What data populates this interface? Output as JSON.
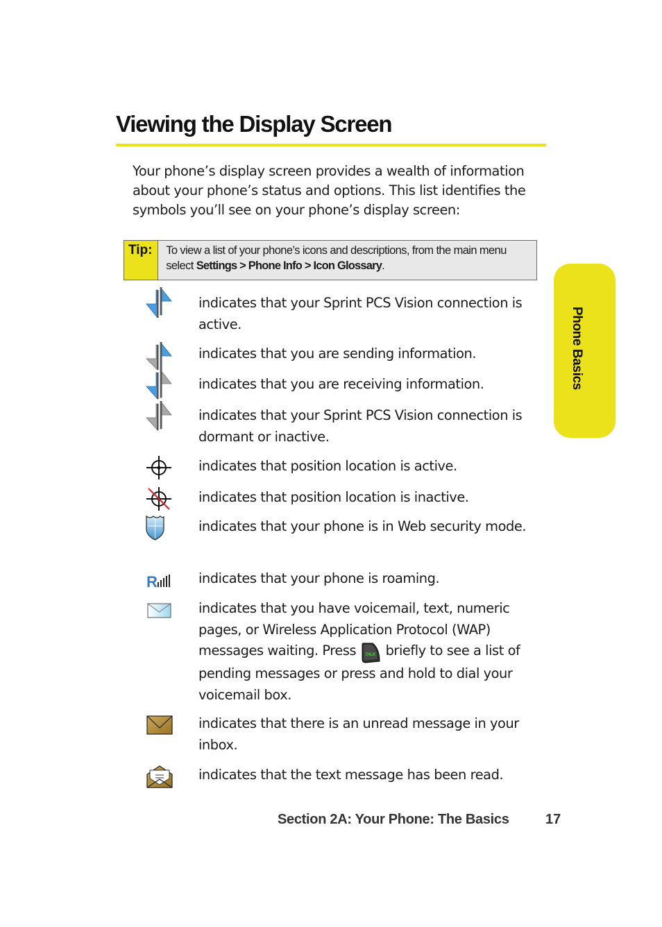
{
  "page": {
    "title": "Viewing the Display Screen",
    "intro": "Your phone’s display screen provides a wealth of information about your phone’s status and options. This list identifies the symbols you’ll see on your phone’s display screen:",
    "accent_color": "#ece21b"
  },
  "tip": {
    "label": "Tip:",
    "text_prefix": "To view a list of your phone’s icons and descriptions, from the main menu select ",
    "path": "Settings > Phone Info > Icon Glossary",
    "text_suffix": "."
  },
  "icons": [
    {
      "icon": "vision-connection-active-icon",
      "description": "indicates that your Sprint PCS Vision connection is active."
    },
    {
      "icon": "vision-sending-icon",
      "description": "indicates that you are sending information."
    },
    {
      "icon": "vision-receiving-icon",
      "description": "indicates that you are receiving information."
    },
    {
      "icon": "vision-dormant-icon",
      "description": "indicates that your Sprint PCS Vision connection is dormant or inactive."
    },
    {
      "icon": "location-on-icon",
      "description": "indicates that position location is active."
    },
    {
      "icon": "location-off-icon",
      "description": "indicates that position location is inactive."
    },
    {
      "icon": "web-security-shield-icon",
      "description": "indicates that your phone is in Web security mode."
    },
    {
      "icon": "roaming-icon",
      "description": "indicates that your phone is roaming."
    },
    {
      "icon": "message-waiting-envelope-icon",
      "description_before": "indicates that you have voicemail, text, numeric pages, or Wireless Application Protocol (WAP) messages waiting. Press ",
      "inline_key": "TALK",
      "description_after": " briefly to see a list of pending messages or press and hold to dial your voicemail box."
    },
    {
      "icon": "unread-message-envelope-icon",
      "description": "indicates that there is an unread message in your inbox."
    },
    {
      "icon": "read-message-envelope-icon",
      "description": "indicates that the text message has been read."
    }
  ],
  "side_tab": {
    "label": "Phone Basics"
  },
  "footer": {
    "section": "Section 2A: Your Phone: The Basics",
    "page_number": "17"
  }
}
